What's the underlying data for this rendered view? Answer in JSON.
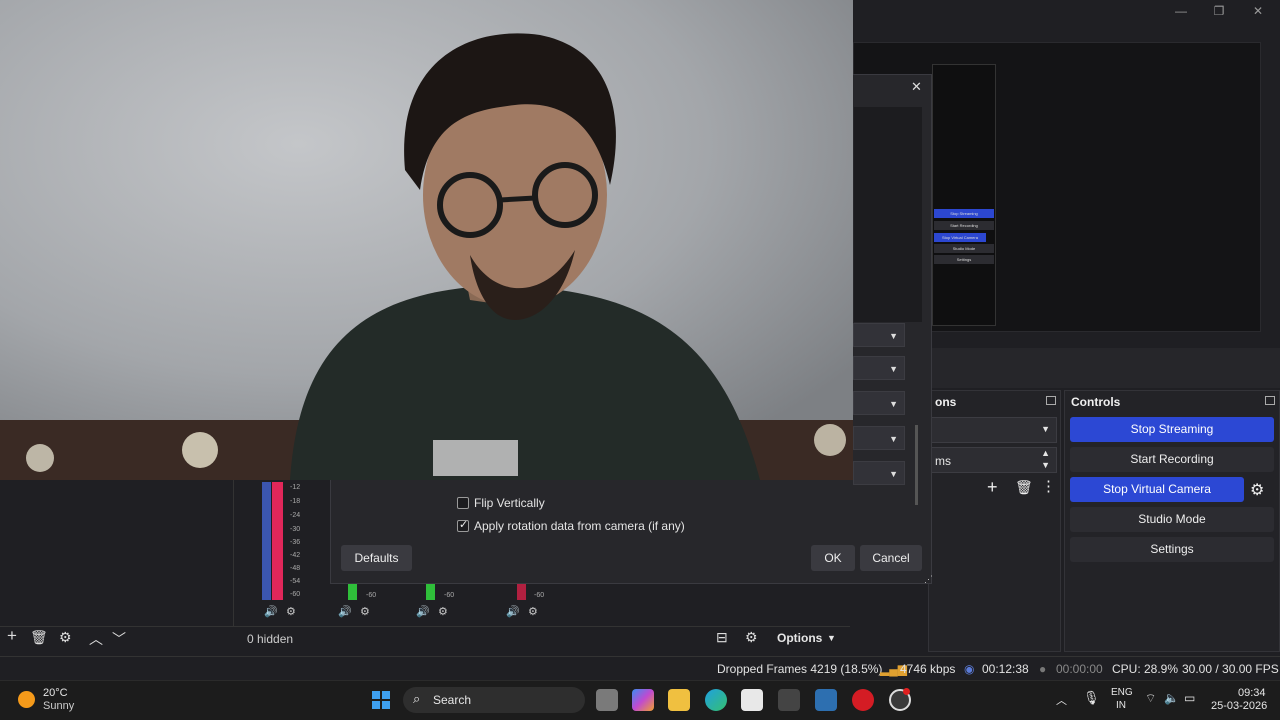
{
  "window": {
    "minimize_glyph": "—",
    "maximize_glyph": "❐",
    "close_glyph": "✕"
  },
  "preview": {
    "mini_controls": [
      "Stop Streaming",
      "Start Recording",
      "Stop Virtual Camera",
      "Studio Mode",
      "Settings"
    ]
  },
  "transitions_dock": {
    "title": "ons",
    "duration_value": "ms"
  },
  "controls_dock": {
    "title": "Controls",
    "buttons": {
      "stop_streaming": "Stop Streaming",
      "start_recording": "Start Recording",
      "stop_virtual_camera": "Stop Virtual Camera",
      "studio_mode": "Studio Mode",
      "settings": "Settings"
    }
  },
  "properties_dialog": {
    "close_glyph": "✕",
    "flip_vertically_label": "Flip Vertically",
    "flip_vertically_checked": false,
    "apply_rotation_label": "Apply rotation data from camera (if any)",
    "apply_rotation_checked": true,
    "defaults_label": "Defaults",
    "ok_label": "OK",
    "cancel_label": "Cancel"
  },
  "mixer": {
    "db_scale": [
      "-12",
      "-18",
      "-24",
      "-30",
      "-36",
      "-42",
      "-48",
      "-54",
      "-60"
    ],
    "small_db": [
      "-60",
      "-60",
      "-60"
    ]
  },
  "sources_toolbar": {
    "hidden_count": "0 hidden",
    "options_label": "Options"
  },
  "status": {
    "dropped_frames": "Dropped Frames 4219 (18.5%)",
    "bitrate": "4746 kbps",
    "stream_time": "00:12:38",
    "record_time": "00:00:00",
    "cpu": "CPU: 28.9%",
    "fps": "30.00 / 30.00 FPS"
  },
  "taskbar": {
    "weather_temp": "20°C",
    "weather_desc": "Sunny",
    "search_label": "Search",
    "language_line1": "ENG",
    "language_line2": "IN",
    "time": "09:34",
    "date": "25-03-2026"
  },
  "colors": {
    "accent_blue": "#2c48d4",
    "meter_red": "#e0275a",
    "meter_green": "#2fbf3a"
  }
}
